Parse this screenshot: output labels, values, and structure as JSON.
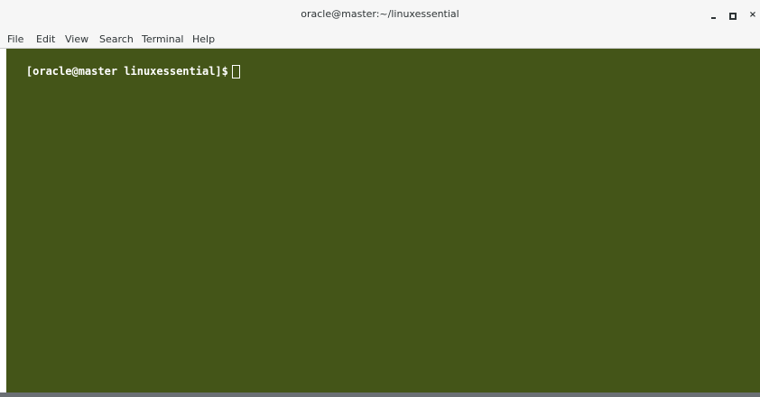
{
  "window": {
    "title": "oracle@master:~/linuxessential"
  },
  "controls": {
    "minimize_icon": "minimize-icon",
    "maximize_icon": "maximize-icon",
    "close_icon": "close-icon",
    "close_glyph": "×"
  },
  "menubar": {
    "items": [
      {
        "label": "File"
      },
      {
        "label": "Edit"
      },
      {
        "label": "View"
      },
      {
        "label": "Search"
      },
      {
        "label": "Terminal"
      },
      {
        "label": "Help"
      }
    ]
  },
  "terminal": {
    "prompt": "[oracle@master linuxessential]$",
    "background_color": "#445518",
    "foreground_color": "#ffffff"
  }
}
